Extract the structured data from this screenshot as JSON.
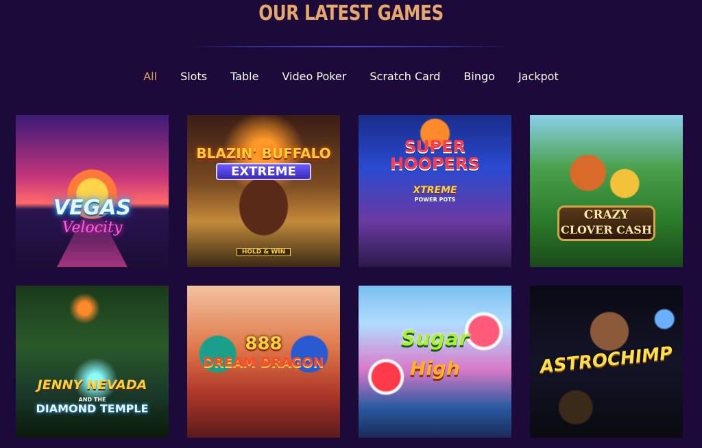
{
  "heading": "OUR LATEST GAMES",
  "filters": [
    "All",
    "Slots",
    "Table",
    "Video Poker",
    "Scratch Card",
    "Bingo",
    "Jackpot"
  ],
  "active_filter": "All",
  "games": [
    {
      "title": "VEGAS",
      "subtitle": "Velocity"
    },
    {
      "title": "BLAZIN' BUFFALO",
      "subtitle": "EXTREME",
      "badge": "HOLD & WIN"
    },
    {
      "title": "SUPER HOOPERS",
      "subtitle": "XTREME",
      "subtitle2": "POWER POTS"
    },
    {
      "title": "CRAZY",
      "subtitle": "CLOVER CASH"
    },
    {
      "title": "JENNY NEVADA",
      "small": "AND THE",
      "subtitle": "DIAMOND TEMPLE"
    },
    {
      "title": "888",
      "subtitle": "DREAM DRAGON"
    },
    {
      "title": "Sugar",
      "subtitle": "High"
    },
    {
      "title": "ASTROCHIMP"
    }
  ],
  "colors": {
    "background": "#1c0a3a",
    "heading": "#e5a86a",
    "active_filter": "#d9a35c",
    "filter": "#ffffff"
  }
}
